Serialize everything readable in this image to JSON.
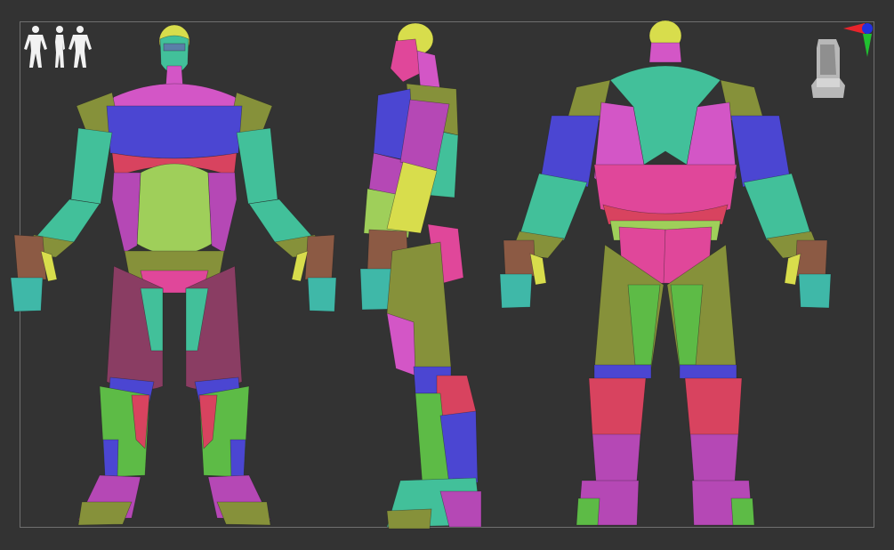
{
  "viewport": {
    "background": "#333333",
    "frame_color": "#6f6f6f"
  },
  "views": [
    {
      "name": "front",
      "icon": "figure-front-icon"
    },
    {
      "name": "side",
      "icon": "figure-side-icon"
    },
    {
      "name": "back",
      "icon": "figure-back-icon"
    }
  ],
  "overlays": {
    "view_thumbnails_icon": "human-silhouettes-icon",
    "axis_gizmo_icon": "xyz-axis-gizmo-icon",
    "nav_cube_icon": "head-navigation-cube-icon"
  },
  "polygroup_colors": {
    "blue": "#4b46d2",
    "purple": "#b548b5",
    "pink": "#e0479a",
    "teal": "#42c09a",
    "lime": "#9fcf5a",
    "olive": "#86913a",
    "magenta": "#d356c6",
    "maroon": "#8a3d63",
    "green": "#5dbb46",
    "yellow": "#d8dd4c",
    "brown": "#8c5a44",
    "red": "#d8435f"
  }
}
